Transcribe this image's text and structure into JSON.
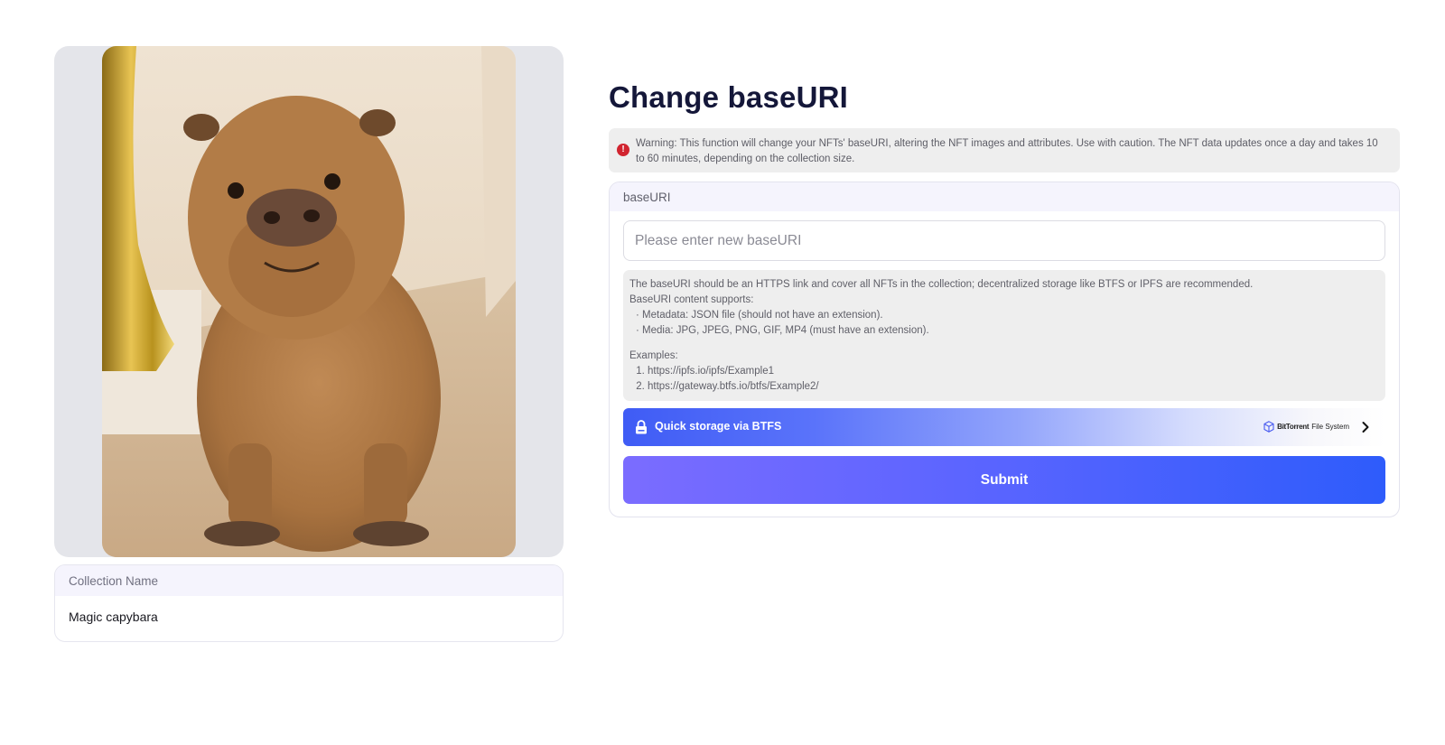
{
  "collection": {
    "image_alt": "Magic capybara",
    "name_header": "Collection Name",
    "name_value": "Magic capybara"
  },
  "page": {
    "title": "Change baseURI",
    "warning": "Warning: This function will change your NFTs' baseURI, altering the NFT images and attributes. Use with caution. The NFT data updates once a day and takes 10 to 60 minutes, depending on the collection size."
  },
  "form": {
    "section_label": "baseURI",
    "input_placeholder": "Please enter new baseURI",
    "input_value": "",
    "help": {
      "intro": "The baseURI should be an HTTPS link and cover all NFTs in the collection; decentralized storage like BTFS or IPFS are recommended.",
      "supports_label": "BaseURI content supports:",
      "supports": [
        "· Metadata: JSON file (should not have an extension).",
        "· Media: JPG, JPEG, PNG, GIF, MP4 (must have an extension)."
      ],
      "examples_label": "Examples:",
      "examples": [
        "https://ipfs.io/ipfs/Example1",
        "https://gateway.btfs.io/btfs/Example2/"
      ]
    },
    "btfs": {
      "label": "Quick storage via BTFS",
      "brand_bold": "BitTorrent",
      "brand_rest": "File System"
    },
    "submit_label": "Submit"
  },
  "colors": {
    "accent": "#2e5cfb",
    "accent_start": "#7b6cff",
    "warning_icon": "#d1242f",
    "title": "#141739"
  },
  "icons": [
    "warning-icon",
    "lock-icon",
    "btfs-cube-icon",
    "chevron-right-icon"
  ]
}
